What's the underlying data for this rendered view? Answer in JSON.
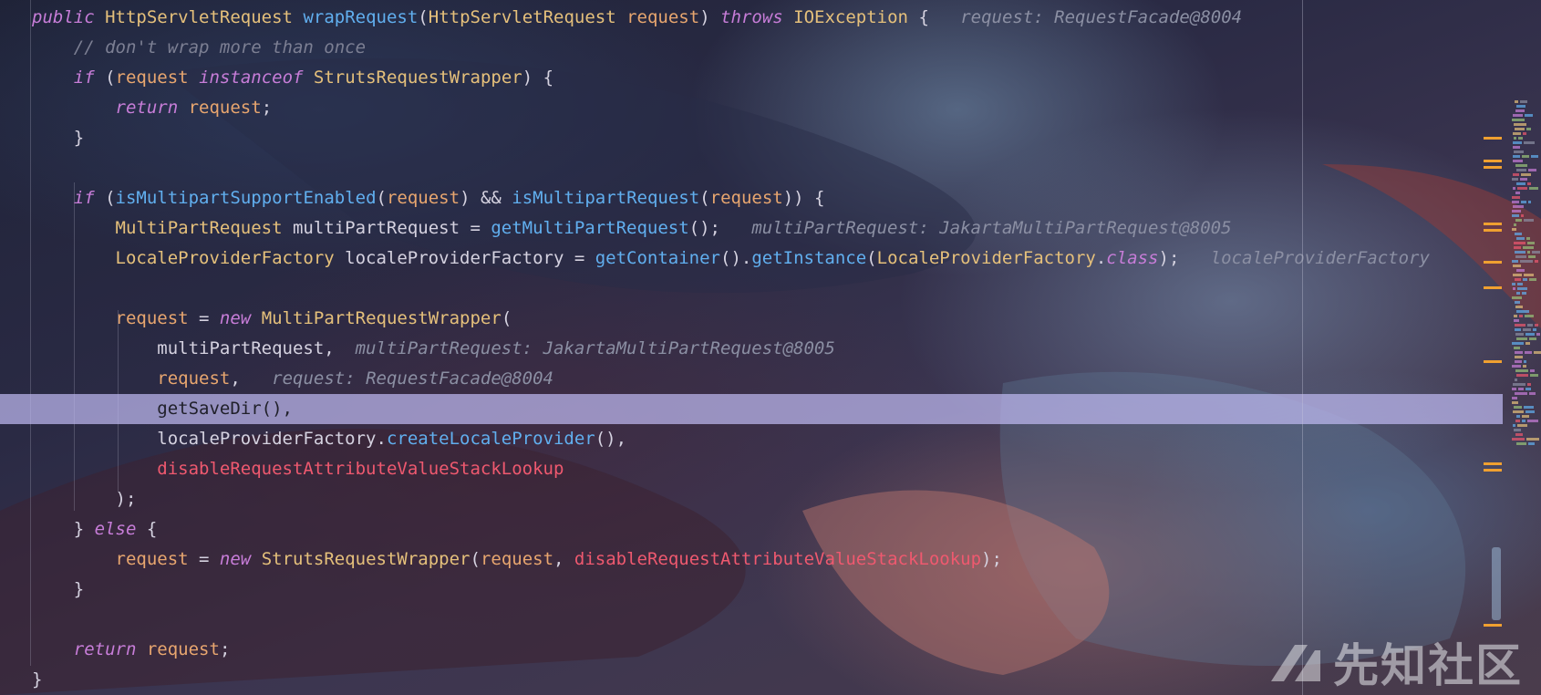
{
  "code": {
    "lines": [
      {
        "tokens": [
          [
            "kw",
            "public"
          ],
          [
            "plain",
            " "
          ],
          [
            "type",
            "HttpServletRequest"
          ],
          [
            "plain",
            " "
          ],
          [
            "fn",
            "wrapRequest"
          ],
          [
            "plain",
            "("
          ],
          [
            "type",
            "HttpServletRequest"
          ],
          [
            "plain",
            " "
          ],
          [
            "param",
            "request"
          ],
          [
            "plain",
            ") "
          ],
          [
            "kw",
            "throws"
          ],
          [
            "plain",
            " "
          ],
          [
            "type",
            "IOException"
          ],
          [
            "plain",
            " {   "
          ],
          [
            "hint",
            "request: RequestFacade@8004"
          ]
        ]
      },
      {
        "tokens": [
          [
            "plain",
            "    "
          ],
          [
            "cmt",
            "// don't wrap more than once"
          ]
        ]
      },
      {
        "tokens": [
          [
            "plain",
            "    "
          ],
          [
            "kw",
            "if"
          ],
          [
            "plain",
            " ("
          ],
          [
            "param",
            "request"
          ],
          [
            "plain",
            " "
          ],
          [
            "kw",
            "instanceof"
          ],
          [
            "plain",
            " "
          ],
          [
            "type",
            "StrutsRequestWrapper"
          ],
          [
            "plain",
            ") {"
          ]
        ]
      },
      {
        "tokens": [
          [
            "plain",
            "        "
          ],
          [
            "kw",
            "return"
          ],
          [
            "plain",
            " "
          ],
          [
            "param",
            "request"
          ],
          [
            "plain",
            ";"
          ]
        ]
      },
      {
        "tokens": [
          [
            "plain",
            "    }"
          ]
        ]
      },
      {
        "tokens": []
      },
      {
        "tokens": [
          [
            "plain",
            "    "
          ],
          [
            "kw",
            "if"
          ],
          [
            "plain",
            " ("
          ],
          [
            "fn",
            "isMultipartSupportEnabled"
          ],
          [
            "plain",
            "("
          ],
          [
            "param",
            "request"
          ],
          [
            "plain",
            ") && "
          ],
          [
            "fn",
            "isMultipartRequest"
          ],
          [
            "plain",
            "("
          ],
          [
            "param",
            "request"
          ],
          [
            "plain",
            ")) {"
          ]
        ]
      },
      {
        "tokens": [
          [
            "plain",
            "        "
          ],
          [
            "type",
            "MultiPartRequest"
          ],
          [
            "plain",
            " multiPartRequest = "
          ],
          [
            "fn",
            "getMultiPartRequest"
          ],
          [
            "plain",
            "();   "
          ],
          [
            "hint",
            "multiPartRequest: JakartaMultiPartRequest@8005"
          ]
        ]
      },
      {
        "tokens": [
          [
            "plain",
            "        "
          ],
          [
            "type",
            "LocaleProviderFactory"
          ],
          [
            "plain",
            " localeProviderFactory = "
          ],
          [
            "fn",
            "getContainer"
          ],
          [
            "plain",
            "()."
          ],
          [
            "fn",
            "getInstance"
          ],
          [
            "plain",
            "("
          ],
          [
            "type",
            "LocaleProviderFactory"
          ],
          [
            "plain",
            "."
          ],
          [
            "cls",
            "class"
          ],
          [
            "plain",
            ");   "
          ],
          [
            "hint",
            "localeProviderFactory"
          ]
        ]
      },
      {
        "tokens": []
      },
      {
        "tokens": [
          [
            "plain",
            "        "
          ],
          [
            "param",
            "request"
          ],
          [
            "plain",
            " = "
          ],
          [
            "kw",
            "new"
          ],
          [
            "plain",
            " "
          ],
          [
            "type",
            "MultiPartRequestWrapper"
          ],
          [
            "plain",
            "("
          ]
        ]
      },
      {
        "tokens": [
          [
            "plain",
            "            multiPartRequest,  "
          ],
          [
            "hint",
            "multiPartRequest: JakartaMultiPartRequest@8005"
          ]
        ]
      },
      {
        "tokens": [
          [
            "plain",
            "            "
          ],
          [
            "param",
            "request"
          ],
          [
            "plain",
            ",   "
          ],
          [
            "hint",
            "request: RequestFacade@8004"
          ]
        ]
      },
      {
        "tokens": [
          [
            "plain",
            "            getSaveDir(),"
          ]
        ],
        "highlight": true
      },
      {
        "tokens": [
          [
            "plain",
            "            localeProviderFactory."
          ],
          [
            "fn",
            "createLocaleProvider"
          ],
          [
            "plain",
            "(),"
          ]
        ]
      },
      {
        "tokens": [
          [
            "plain",
            "            "
          ],
          [
            "field",
            "disableRequestAttributeValueStackLookup"
          ]
        ]
      },
      {
        "tokens": [
          [
            "plain",
            "        );"
          ]
        ]
      },
      {
        "tokens": [
          [
            "plain",
            "    } "
          ],
          [
            "kw",
            "else"
          ],
          [
            "plain",
            " {"
          ]
        ]
      },
      {
        "tokens": [
          [
            "plain",
            "        "
          ],
          [
            "param",
            "request"
          ],
          [
            "plain",
            " = "
          ],
          [
            "kw",
            "new"
          ],
          [
            "plain",
            " "
          ],
          [
            "type",
            "StrutsRequestWrapper"
          ],
          [
            "plain",
            "("
          ],
          [
            "param",
            "request"
          ],
          [
            "plain",
            ", "
          ],
          [
            "field",
            "disableRequestAttributeValueStackLookup"
          ],
          [
            "plain",
            ");"
          ]
        ]
      },
      {
        "tokens": [
          [
            "plain",
            "    }"
          ]
        ]
      },
      {
        "tokens": []
      },
      {
        "tokens": [
          [
            "plain",
            "    "
          ],
          [
            "kw",
            "return"
          ],
          [
            "plain",
            " "
          ],
          [
            "param",
            "request"
          ],
          [
            "plain",
            ";"
          ]
        ]
      },
      {
        "tokens": [
          [
            "plain",
            "}"
          ]
        ]
      }
    ]
  },
  "watermark": {
    "text": "先知社区"
  },
  "colors": {
    "highlight": "#bdb8f0",
    "keyword": "#c77dd8",
    "type": "#e5c07b",
    "function": "#61afef",
    "param": "#e8a66f",
    "field": "#ef596f",
    "hint": "#8b8fa3",
    "marker": "#f0a030"
  }
}
